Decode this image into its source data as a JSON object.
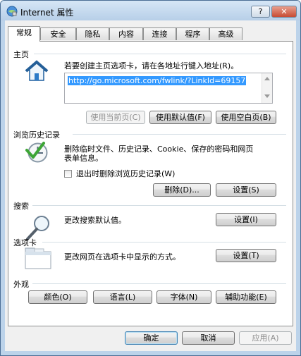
{
  "window": {
    "title": "Internet 属性",
    "help_label": "?",
    "close_label": "✕"
  },
  "tabs": [
    {
      "label": "常规",
      "active": true
    },
    {
      "label": "安全"
    },
    {
      "label": "隐私"
    },
    {
      "label": "内容"
    },
    {
      "label": "连接"
    },
    {
      "label": "程序"
    },
    {
      "label": "高级"
    }
  ],
  "home": {
    "section_title": "主页",
    "description": "若要创建主页选项卡，请在各地址行键入地址(R)。",
    "url": "http://go.microsoft.com/fwlink/?LinkId=69157",
    "use_current_label": "使用当前页(C)",
    "use_default_label": "使用默认值(F)",
    "use_blank_label": "使用空白页(B)"
  },
  "history": {
    "section_title": "浏览历史记录",
    "description_line1": "删除临时文件、历史记录、Cookie、保存的密码和网页",
    "description_line2": "表单信息。",
    "checkbox_label": "退出时删除浏览历史记录(W)",
    "delete_label": "删除(D)...",
    "settings_label": "设置(S)"
  },
  "search": {
    "section_title": "搜索",
    "description": "更改搜索默认值。",
    "settings_label": "设置(I)"
  },
  "tabs_section": {
    "section_title": "选项卡",
    "description": "更改网页在选项卡中显示的方式。",
    "settings_label": "设置(T)"
  },
  "appearance": {
    "section_title": "外观",
    "colors_label": "颜色(O)",
    "languages_label": "语言(L)",
    "fonts_label": "字体(N)",
    "accessibility_label": "辅助功能(E)"
  },
  "footer": {
    "ok_label": "确定",
    "cancel_label": "取消",
    "apply_label": "应用(A)"
  }
}
